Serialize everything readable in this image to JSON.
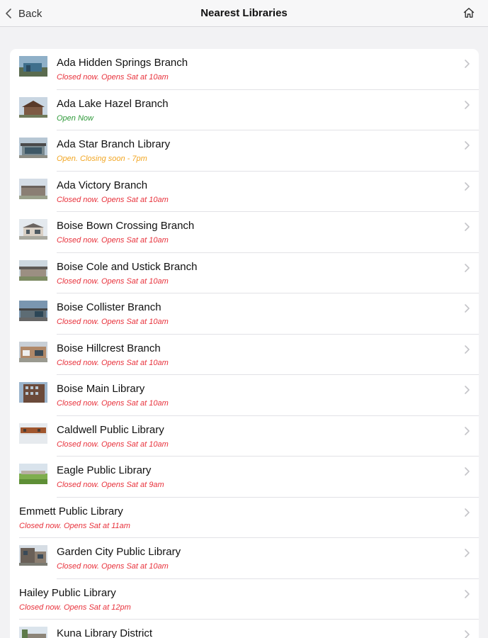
{
  "navbar": {
    "back_label": "Back",
    "title": "Nearest Libraries",
    "home_icon": "home-icon"
  },
  "colors": {
    "closed": "#e8323c",
    "open": "#2f9a3a",
    "closing_soon": "#f2a623"
  },
  "libraries": [
    {
      "name": "Ada Hidden Springs Branch",
      "status": "Closed now. Opens Sat at 10am",
      "state": "closed",
      "has_image": true
    },
    {
      "name": "Ada Lake Hazel Branch",
      "status": "Open Now",
      "state": "open",
      "has_image": true
    },
    {
      "name": "Ada Star Branch Library",
      "status": "Open. Closing soon - 7pm",
      "state": "soon",
      "has_image": true
    },
    {
      "name": "Ada Victory Branch",
      "status": "Closed now. Opens Sat at 10am",
      "state": "closed",
      "has_image": true
    },
    {
      "name": "Boise Bown Crossing Branch",
      "status": "Closed now. Opens Sat at 10am",
      "state": "closed",
      "has_image": true
    },
    {
      "name": "Boise Cole and Ustick Branch",
      "status": "Closed now. Opens Sat at 10am",
      "state": "closed",
      "has_image": true
    },
    {
      "name": "Boise Collister Branch",
      "status": "Closed now. Opens Sat at 10am",
      "state": "closed",
      "has_image": true
    },
    {
      "name": "Boise Hillcrest Branch",
      "status": "Closed now. Opens Sat at 10am",
      "state": "closed",
      "has_image": true
    },
    {
      "name": "Boise Main Library",
      "status": "Closed now. Opens Sat at 10am",
      "state": "closed",
      "has_image": true
    },
    {
      "name": "Caldwell Public Library",
      "status": "Closed now. Opens Sat at 10am",
      "state": "closed",
      "has_image": true
    },
    {
      "name": "Eagle Public Library",
      "status": "Closed now. Opens Sat at 9am",
      "state": "closed",
      "has_image": true
    },
    {
      "name": "Emmett Public Library",
      "status": "Closed now. Opens Sat at 11am",
      "state": "closed",
      "has_image": false
    },
    {
      "name": "Garden City Public Library",
      "status": "Closed now. Opens Sat at 10am",
      "state": "closed",
      "has_image": true
    },
    {
      "name": "Hailey Public Library",
      "status": "Closed now. Opens Sat at 12pm",
      "state": "closed",
      "has_image": false
    },
    {
      "name": "Kuna Library District",
      "status": "",
      "state": "closed",
      "has_image": true
    }
  ]
}
